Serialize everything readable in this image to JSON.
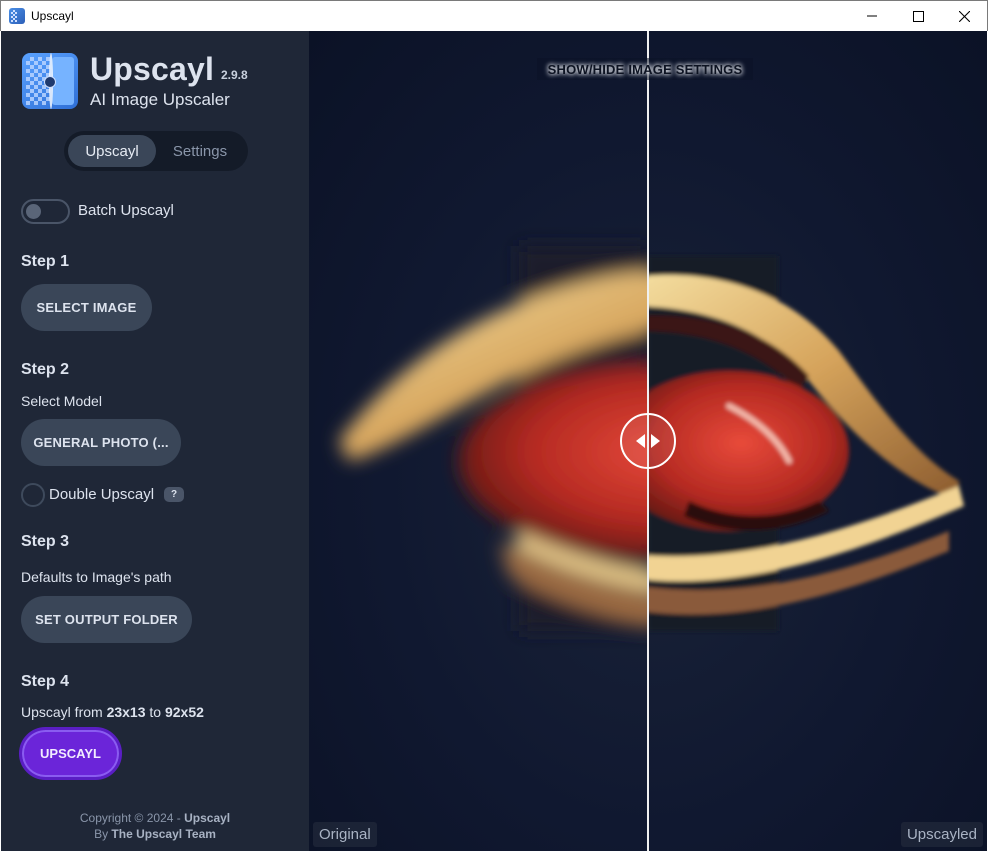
{
  "window": {
    "title": "Upscayl"
  },
  "sidebar": {
    "app_name": "Upscayl",
    "version": "2.9.8",
    "tagline": "AI Image Upscaler",
    "tabs": [
      {
        "label": "Upscayl",
        "active": true
      },
      {
        "label": "Settings",
        "active": false
      }
    ],
    "batch_toggle": {
      "label": "Batch Upscayl",
      "on": false
    },
    "step1": {
      "title": "Step 1",
      "button": "SELECT IMAGE"
    },
    "step2": {
      "title": "Step 2",
      "subtitle": "Select Model",
      "model_button": "GENERAL PHOTO (...",
      "double_upscale": {
        "label": "Double Upscayl",
        "checked": false,
        "help_badge": "?"
      }
    },
    "step3": {
      "title": "Step 3",
      "subtitle": "Defaults to Image's path",
      "button": "SET OUTPUT FOLDER"
    },
    "step4": {
      "title": "Step 4",
      "upscale_prefix": "Upscayl from",
      "from_size": "23x13",
      "to_word": "to",
      "to_size": "92x52",
      "button": "UPSCAYL"
    },
    "copyright": {
      "line1_prefix": "Copyright © 2024 - ",
      "line1_brand": "Upscayl",
      "line2_prefix": "By ",
      "line2_team": "The Upscayl Team"
    }
  },
  "compare": {
    "settings_toggle": "SHOW/HIDE IMAGE SETTINGS",
    "left_label": "Original",
    "right_label": "Upscayled",
    "slider_position": 0.5
  },
  "colors": {
    "sidebar_bg": "#1f2737",
    "button_bg": "#3a4658",
    "accent_purple": "#6b25d9",
    "main_bg": "#101830"
  },
  "icons": {
    "window_minimize": "minimize-icon",
    "window_maximize": "maximize-icon",
    "window_close": "close-icon",
    "compare_handle": "left-right-arrows-icon"
  }
}
